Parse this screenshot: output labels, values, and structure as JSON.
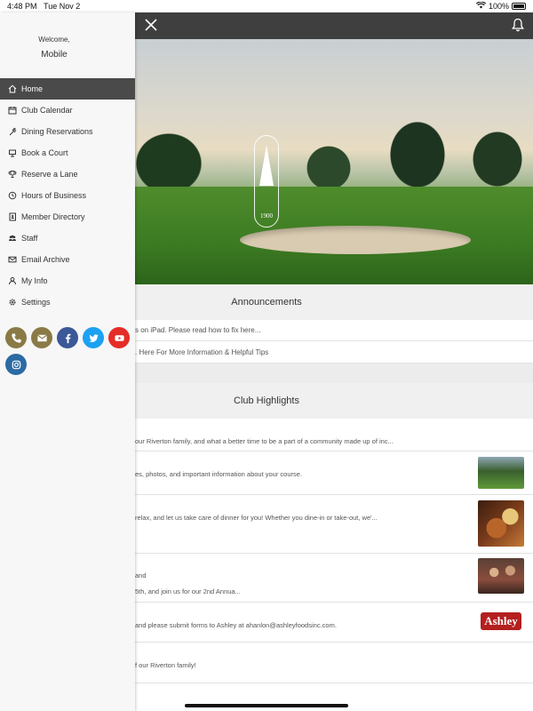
{
  "status_bar": {
    "time": "4:48 PM",
    "date": "Tue Nov 2",
    "battery": "100%"
  },
  "drawer": {
    "welcome": "Welcome,",
    "username": "Mobile",
    "menu": [
      {
        "label": "Home",
        "icon": "home-icon",
        "active": true
      },
      {
        "label": "Club Calendar",
        "icon": "calendar-icon"
      },
      {
        "label": "Dining Reservations",
        "icon": "utensils-icon"
      },
      {
        "label": "Book a Court",
        "icon": "court-icon"
      },
      {
        "label": "Reserve a Lane",
        "icon": "trophy-icon"
      },
      {
        "label": "Hours of Business",
        "icon": "clock-icon"
      },
      {
        "label": "Member Directory",
        "icon": "address-book-icon"
      },
      {
        "label": "Staff",
        "icon": "users-icon"
      },
      {
        "label": "Email Archive",
        "icon": "envelope-icon"
      },
      {
        "label": "My Info",
        "icon": "user-icon"
      },
      {
        "label": "Settings",
        "icon": "gear-icon"
      }
    ],
    "socials": [
      {
        "name": "phone",
        "color": "#8a7a45"
      },
      {
        "name": "email",
        "color": "#8a7a45"
      },
      {
        "name": "facebook",
        "color": "#3b5998"
      },
      {
        "name": "twitter",
        "color": "#1da1f2"
      },
      {
        "name": "youtube",
        "color": "#e52d27"
      },
      {
        "name": "instagram",
        "color": "#2b6aa3"
      }
    ]
  },
  "hero": {
    "logo_year": "1900"
  },
  "announcements": {
    "title": "Announcements",
    "items": [
      "s on iPad. Please read how to fix here...",
      ". Here For More Information & Helpful Tips"
    ]
  },
  "highlights": {
    "title": "Club Highlights",
    "items": [
      {
        "line1": "our Riverton family, and what a better time to be a part of a community made up of inc...",
        "thumb": "none"
      },
      {
        "line1": "es, photos, and important information about your course.",
        "thumb": "golf"
      },
      {
        "line1": "relax, and let us take care of dinner for you! Whether you dine-in or take-out, we'...",
        "thumb": "food"
      },
      {
        "line1": "and",
        "line2": "5th, and join us for our 2nd Annua...",
        "thumb": "people"
      },
      {
        "line1": "and please submit forms to Ashley at ahanlon@ashleyfoodsinc.com.",
        "thumb": "ashley",
        "thumb_text": "Ashley"
      },
      {
        "line1": "f our Riverton family!",
        "thumb": "none"
      }
    ]
  }
}
